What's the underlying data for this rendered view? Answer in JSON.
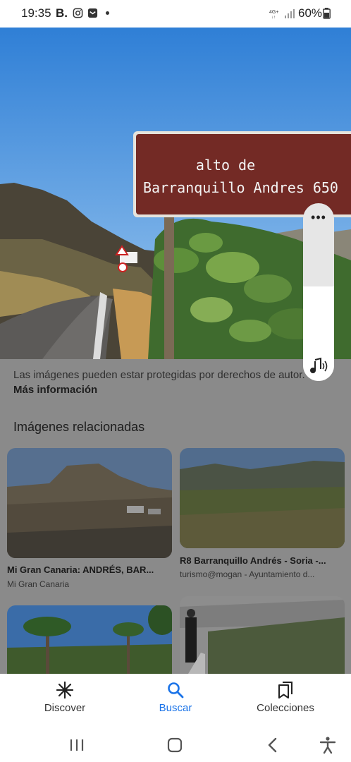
{
  "status_bar": {
    "time": "19:35",
    "carrier_label": "B.",
    "network": "4G+",
    "battery": "60%"
  },
  "photo": {
    "sign_line1": "alto de",
    "sign_line2": "Barranquillo Andres 650"
  },
  "volume_panel": {
    "more_label": "•••",
    "level_fraction": 0.53
  },
  "notice": {
    "text": "Las imágenes pueden estar protegidas por derechos de autor.",
    "link": "Más información"
  },
  "related": {
    "title": "Imágenes relacionadas",
    "items": [
      {
        "title": "Mi Gran Canaria: ANDRÉS, BAR...",
        "source": "Mi Gran Canaria"
      },
      {
        "title": "R8 Barranquillo Andrés - Soria -...",
        "source": "turismo@mogan - Ayuntamiento d..."
      },
      {
        "title": "",
        "source": ""
      },
      {
        "title": "",
        "source": ""
      }
    ]
  },
  "bottom_nav": {
    "discover": "Discover",
    "search": "Buscar",
    "collections": "Colecciones",
    "active": "Buscar",
    "accent_color": "#1a73e8"
  },
  "icons": {
    "status": [
      "instagram-icon",
      "mail-icon",
      "signal-icon",
      "battery-icon"
    ],
    "nav": [
      "discover-asterisk-icon",
      "search-icon",
      "collections-icon"
    ],
    "system": [
      "recent-apps-icon",
      "home-icon",
      "back-icon",
      "accessibility-icon"
    ]
  }
}
